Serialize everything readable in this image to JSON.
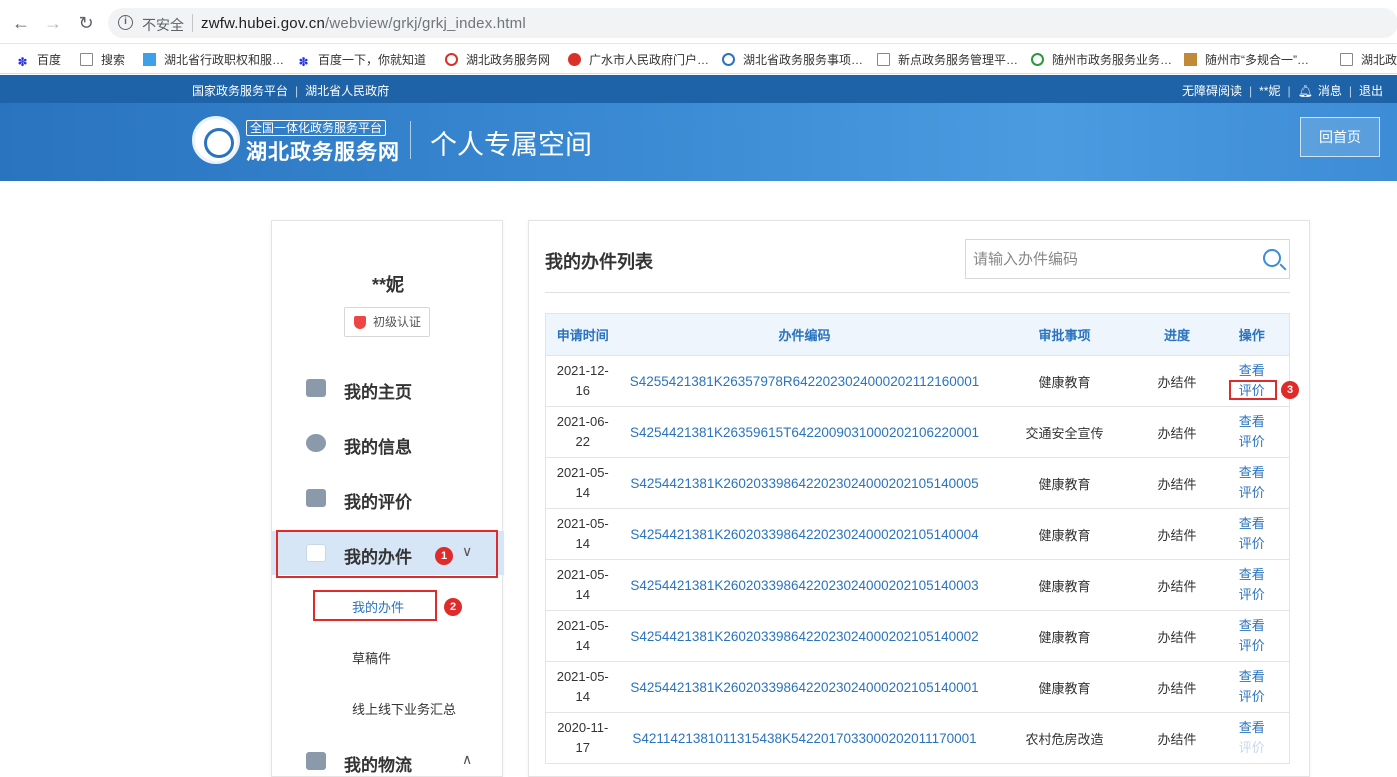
{
  "browser": {
    "insecure_label": "不安全",
    "url_host": "zwfw.hubei.gov.cn",
    "url_path": "/webview/grkj/grkj_index.html",
    "bookmarks": [
      "百度",
      "搜索",
      "湖北省行政职权和服…",
      "百度一下，你就知道",
      "湖北政务服务网",
      "广水市人民政府门户…",
      "湖北省政务服务事项…",
      "新点政务服务管理平…",
      "随州市政务服务业务…",
      "随州市“多规合一”…",
      "湖北政"
    ]
  },
  "header": {
    "links_left": [
      "国家政务服务平台",
      "湖北省人民政府"
    ],
    "links_right": [
      "无障碍阅读",
      "**妮",
      "消息",
      "退出"
    ],
    "logo_sub": "全国一体化政务服务平台",
    "logo_main": "湖北政务服务网",
    "space_title": "个人专属空间",
    "home_button": "回首页"
  },
  "sidebar": {
    "username": "**妮",
    "auth_level": "初级认证",
    "menu": [
      {
        "label": "我的主页"
      },
      {
        "label": "我的信息"
      },
      {
        "label": "我的评价"
      },
      {
        "label": "我的办件"
      },
      {
        "label": "我的物流"
      }
    ],
    "submenu": [
      "我的办件",
      "草稿件",
      "线上线下业务汇总"
    ]
  },
  "main": {
    "title": "我的办件列表",
    "search_placeholder": "请输入办件编码",
    "columns": [
      "申请时间",
      "办件编码",
      "审批事项",
      "进度",
      "操作"
    ],
    "view_label": "查看",
    "rate_label": "评价",
    "rows": [
      {
        "date1": "2021-12-",
        "date2": "16",
        "code": "S4255421381K26357978R64220230240002021121600​01",
        "item": "健康教育",
        "status": "办结件"
      },
      {
        "date1": "2021-06-",
        "date2": "22",
        "code": "S4254421381K26359615T642200903100020210622000​1",
        "item": "交通安全宣传",
        "status": "办结件"
      },
      {
        "date1": "2021-05-",
        "date2": "14",
        "code": "S4254421381K260203398642202302400020210514000​5",
        "item": "健康教育",
        "status": "办结件"
      },
      {
        "date1": "2021-05-",
        "date2": "14",
        "code": "S4254421381K260203398642202302400020210514000​4",
        "item": "健康教育",
        "status": "办结件"
      },
      {
        "date1": "2021-05-",
        "date2": "14",
        "code": "S4254421381K260203398642202302400020210514000​3",
        "item": "健康教育",
        "status": "办结件"
      },
      {
        "date1": "2021-05-",
        "date2": "14",
        "code": "S4254421381K260203398642202302400020210514000​2",
        "item": "健康教育",
        "status": "办结件"
      },
      {
        "date1": "2021-05-",
        "date2": "14",
        "code": "S4254421381K260203398642202302400020210514000​1",
        "item": "健康教育",
        "status": "办结件"
      },
      {
        "date1": "2020-11-",
        "date2": "17",
        "code": "S4211421381011315438K542201703300020201117000​1",
        "item": "农村危房改造",
        "status": "办结件"
      }
    ]
  },
  "annotations": [
    "1",
    "2",
    "3"
  ]
}
